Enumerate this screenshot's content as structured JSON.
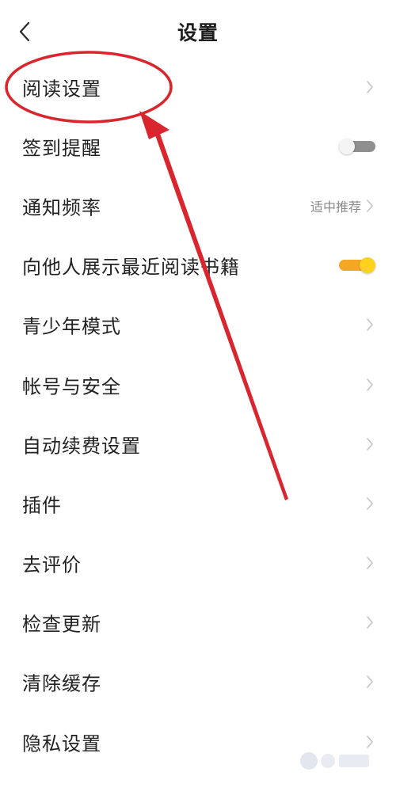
{
  "header": {
    "title": "设置",
    "back_icon": "chevron-left-icon"
  },
  "settings": {
    "items": [
      {
        "label": "阅读设置",
        "control": "chevron"
      },
      {
        "label": "签到提醒",
        "control": "toggle",
        "toggle_on": false
      },
      {
        "label": "通知频率",
        "control": "chevron",
        "value": "适中推荐"
      },
      {
        "label": "向他人展示最近阅读书籍",
        "control": "toggle",
        "toggle_on": true
      },
      {
        "label": "青少年模式",
        "control": "chevron"
      },
      {
        "label": "帐号与安全",
        "control": "chevron"
      },
      {
        "label": "自动续费设置",
        "control": "chevron"
      },
      {
        "label": "插件",
        "control": "chevron"
      },
      {
        "label": "去评价",
        "control": "chevron"
      },
      {
        "label": "检查更新",
        "control": "chevron"
      },
      {
        "label": "清除缓存",
        "control": "chevron"
      },
      {
        "label": "隐私设置",
        "control": "chevron"
      }
    ]
  },
  "colors": {
    "toggle_on_track": "#f5a623",
    "toggle_on_knob": "#ffd21e",
    "toggle_off_track": "#8f8f8f",
    "annotation_red": "#d9262e"
  },
  "annotation": {
    "shapes": [
      "ellipse-highlight",
      "arrow"
    ],
    "highlighted_item": "阅读设置"
  }
}
